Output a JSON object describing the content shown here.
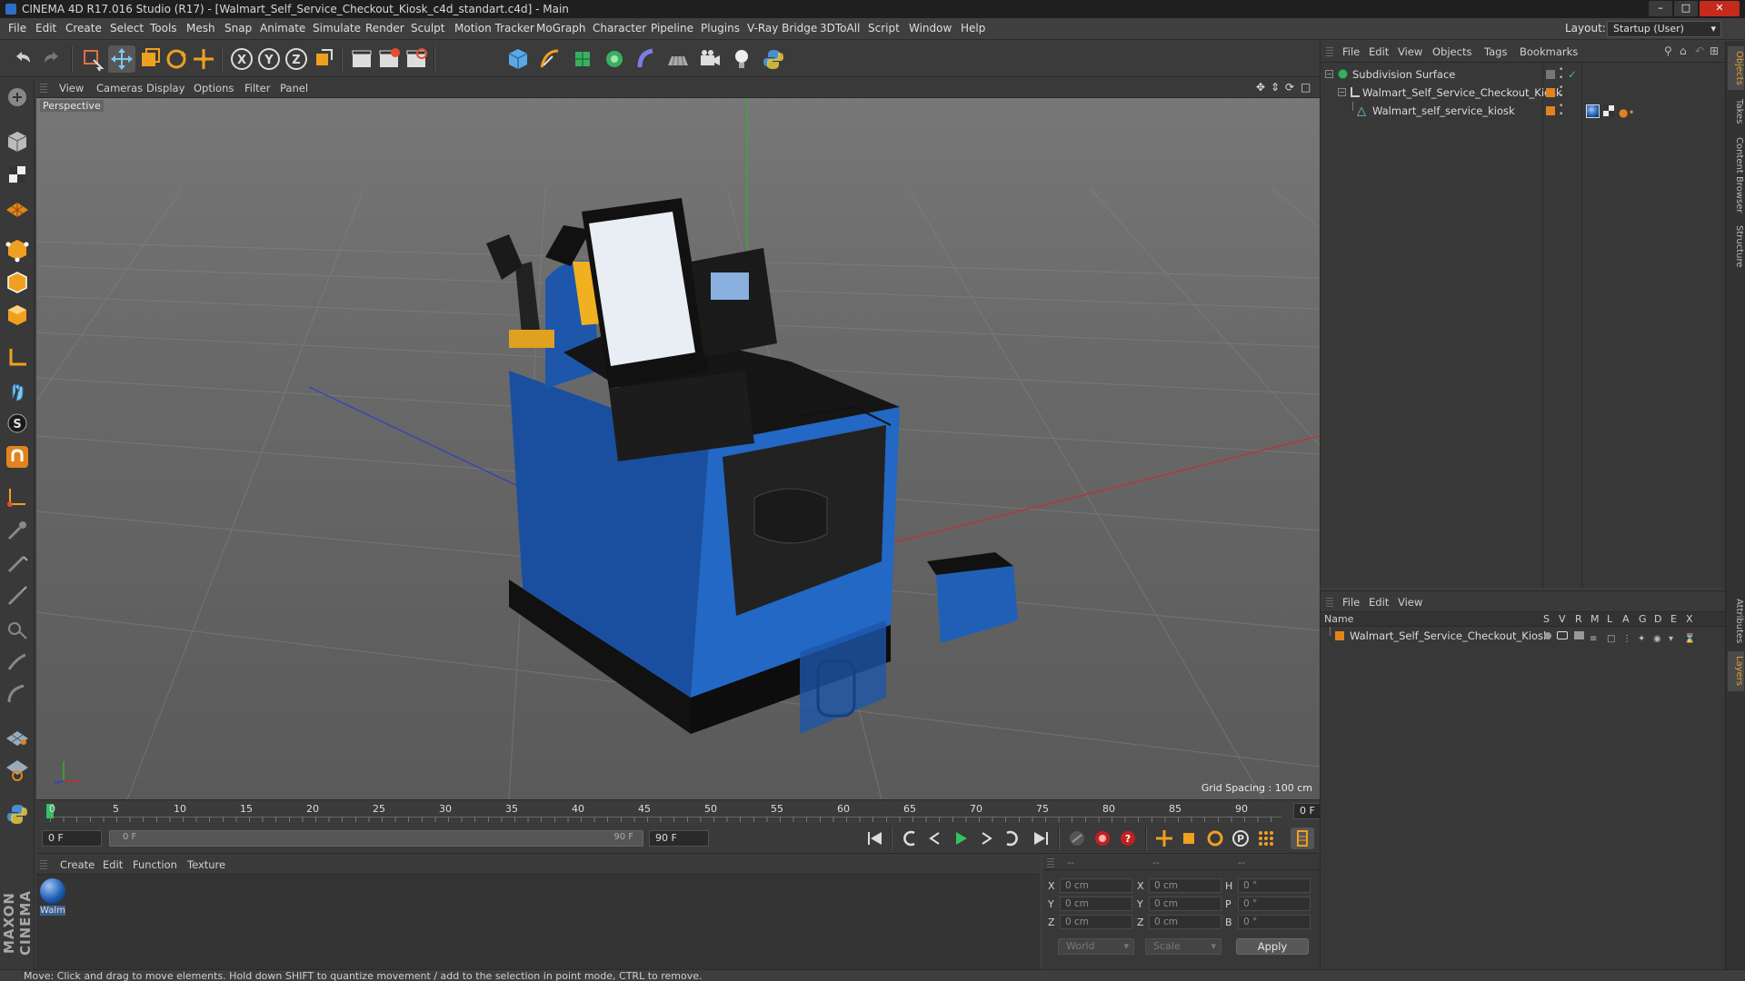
{
  "window": {
    "title": "CINEMA 4D R17.016 Studio (R17) - [Walmart_Self_Service_Checkout_Kiosk_c4d_standart.c4d] - Main"
  },
  "menu": {
    "items": [
      "File",
      "Edit",
      "Create",
      "Select",
      "Tools",
      "Mesh",
      "Snap",
      "Animate",
      "Simulate",
      "Render",
      "Sculpt",
      "Motion Tracker",
      "MoGraph",
      "Character",
      "Pipeline",
      "Plugins",
      "V-Ray Bridge",
      "3DToAll",
      "Script",
      "Window",
      "Help"
    ],
    "layout_label": "Layout:",
    "layout_value": "Startup (User)"
  },
  "viewport": {
    "menu": [
      "View",
      "Cameras",
      "Display",
      "Options",
      "Filter",
      "Panel"
    ],
    "label": "Perspective",
    "grid_spacing": "Grid Spacing : 100 cm"
  },
  "timeline": {
    "ticks": [
      "0",
      "5",
      "10",
      "15",
      "20",
      "25",
      "30",
      "35",
      "40",
      "45",
      "50",
      "55",
      "60",
      "65",
      "70",
      "75",
      "80",
      "85",
      "90"
    ],
    "current_frame": "0 F"
  },
  "transport": {
    "start_field": "0 F",
    "range_start": "0 F",
    "range_end": "90 F",
    "end_field": "90 F"
  },
  "material_manager": {
    "menu": [
      "Create",
      "Edit",
      "Function",
      "Texture"
    ],
    "materials": [
      {
        "label": "Walm"
      }
    ]
  },
  "coord_manager": {
    "headers": [
      "--",
      "--",
      "--"
    ],
    "rows": [
      {
        "axis": "X",
        "pos": "0 cm",
        "size_axis": "X",
        "size": "0 cm",
        "rot_axis": "H",
        "rot": "0 °"
      },
      {
        "axis": "Y",
        "pos": "0 cm",
        "size_axis": "Y",
        "size": "0 cm",
        "rot_axis": "P",
        "rot": "0 °"
      },
      {
        "axis": "Z",
        "pos": "0 cm",
        "size_axis": "Z",
        "size": "0 cm",
        "rot_axis": "B",
        "rot": "0 °"
      }
    ],
    "mode_select": "World",
    "size_select": "Scale",
    "apply_label": "Apply"
  },
  "object_manager": {
    "menu": [
      "File",
      "Edit",
      "View",
      "Objects",
      "Tags",
      "Bookmarks"
    ],
    "objects": [
      {
        "name": "Subdivision Surface"
      },
      {
        "name": "Walmart_Self_Service_Checkout_Kiosk"
      },
      {
        "name": "Walmart_self_service_kiosk"
      }
    ]
  },
  "layer_manager": {
    "menu": [
      "File",
      "Edit",
      "View"
    ],
    "header_name": "Name",
    "columns": [
      "S",
      "V",
      "R",
      "M",
      "L",
      "A",
      "G",
      "D",
      "E",
      "X"
    ],
    "layers": [
      {
        "name": "Walmart_Self_Service_Checkout_Kiosk"
      }
    ]
  },
  "right_tabs": [
    "Objects",
    "Takes",
    "Content Browser",
    "Structure",
    "Attributes",
    "Layers"
  ],
  "status": {
    "text": "Move: Click and drag to move elements. Hold down SHIFT to quantize movement / add to the selection in point mode, CTRL to remove."
  },
  "branding": {
    "logo_text": "MAXON CINEMA 4D"
  },
  "colors": {
    "accent_orange": "#e0841e",
    "kiosk_blue": "#1f5fb4",
    "x_axis": "#c03030",
    "y_axis": "#30b030",
    "z_axis": "#3040c0"
  }
}
